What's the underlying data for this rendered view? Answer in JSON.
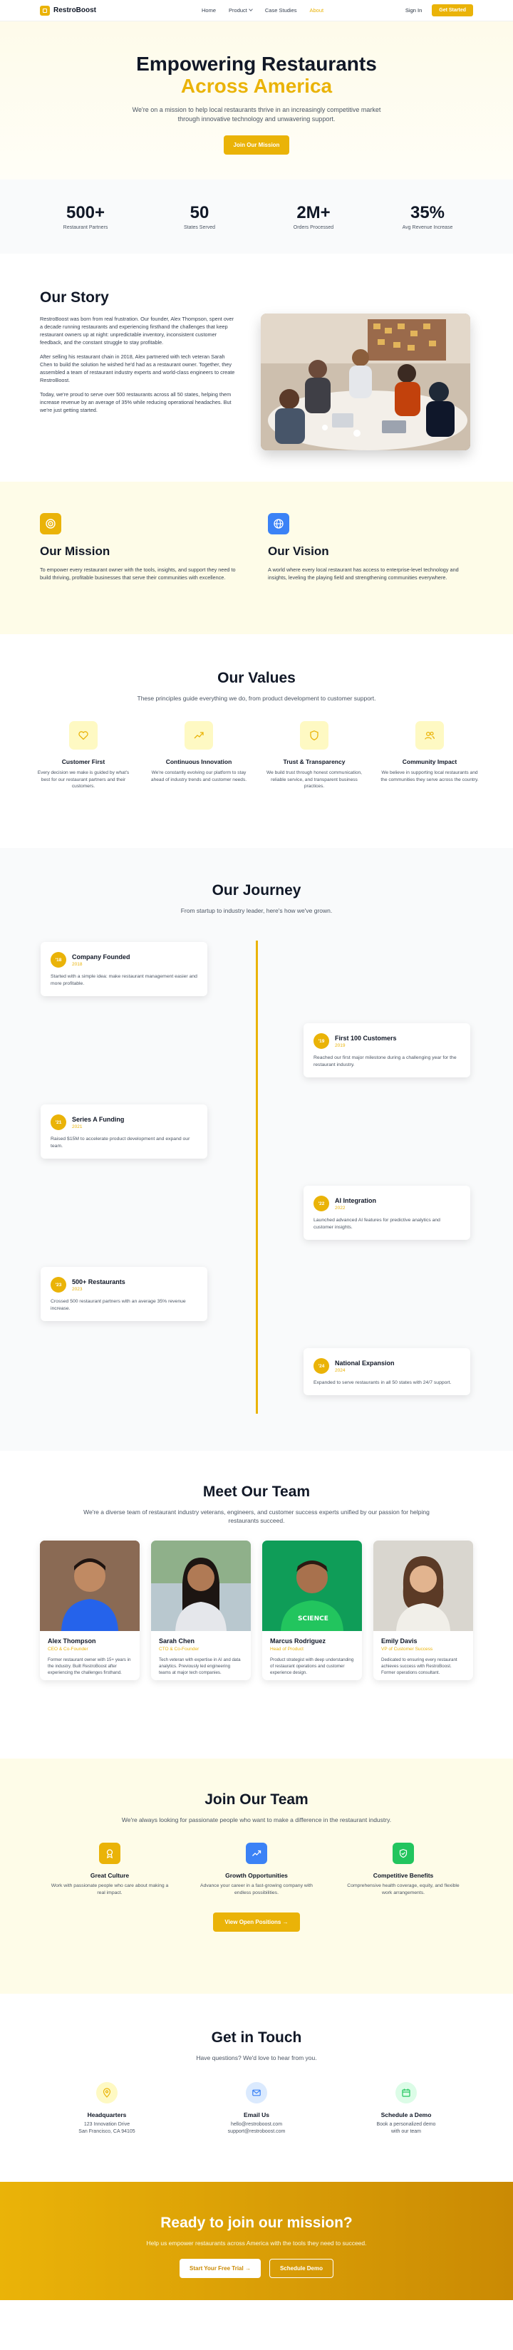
{
  "nav": {
    "brand": "RestroBoost",
    "links": [
      {
        "label": "Home"
      },
      {
        "label": "Product"
      },
      {
        "label": "Case Studies"
      },
      {
        "label": "About"
      }
    ],
    "sign_in": "Sign In",
    "get_started": "Get Started"
  },
  "hero": {
    "title_line1": "Empowering Restaurants",
    "title_line2": "Across America",
    "subtitle": "We're on a mission to help local restaurants thrive in an increasingly competitive market through innovative technology and unwavering support.",
    "cta": "Join Our Mission"
  },
  "stats": [
    {
      "value": "500+",
      "label": "Restaurant Partners"
    },
    {
      "value": "50",
      "label": "States Served"
    },
    {
      "value": "2M+",
      "label": "Orders Processed"
    },
    {
      "value": "35%",
      "label": "Avg Revenue Increase"
    }
  ],
  "story": {
    "title": "Our Story",
    "paragraphs": [
      "RestroBoost was born from real frustration. Our founder, Alex Thompson, spent over a decade running restaurants and experiencing firsthand the challenges that keep restaurant owners up at night: unpredictable inventory, inconsistent customer feedback, and the constant struggle to stay profitable.",
      "After selling his restaurant chain in 2018, Alex partnered with tech veteran Sarah Chen to build the solution he wished he'd had as a restaurant owner. Together, they assembled a team of restaurant industry experts and world-class engineers to create RestroBoost.",
      "Today, we're proud to serve over 500 restaurants across all 50 states, helping them increase revenue by an average of 35% while reducing operational headaches. But we're just getting started."
    ]
  },
  "mission": {
    "title": "Our Mission",
    "text": "To empower every restaurant owner with the tools, insights, and support they need to build thriving, profitable businesses that serve their communities with excellence."
  },
  "vision": {
    "title": "Our Vision",
    "text": "A world where every local restaurant has access to enterprise-level technology and insights, leveling the playing field and strengthening communities everywhere."
  },
  "values": {
    "title": "Our Values",
    "subtitle": "These principles guide everything we do, from product development to customer support.",
    "items": [
      {
        "title": "Customer First",
        "text": "Every decision we make is guided by what's best for our restaurant partners and their customers.",
        "icon": "heart-icon"
      },
      {
        "title": "Continuous Innovation",
        "text": "We're constantly evolving our platform to stay ahead of industry trends and customer needs.",
        "icon": "trending-up-icon"
      },
      {
        "title": "Trust & Transparency",
        "text": "We build trust through honest communication, reliable service, and transparent business practices.",
        "icon": "shield-icon"
      },
      {
        "title": "Community Impact",
        "text": "We believe in supporting local restaurants and the communities they serve across the country.",
        "icon": "users-icon"
      }
    ]
  },
  "journey": {
    "title": "Our Journey",
    "subtitle": "From startup to industry leader, here's how we've grown.",
    "events": [
      {
        "badge": "'18",
        "title": "Company Founded",
        "year": "2018",
        "text": "Started with a simple idea: make restaurant management easier and more profitable."
      },
      {
        "badge": "'19",
        "title": "First 100 Customers",
        "year": "2019",
        "text": "Reached our first major milestone during a challenging year for the restaurant industry."
      },
      {
        "badge": "'21",
        "title": "Series A Funding",
        "year": "2021",
        "text": "Raised $15M to accelerate product development and expand our team."
      },
      {
        "badge": "'22",
        "title": "AI Integration",
        "year": "2022",
        "text": "Launched advanced AI features for predictive analytics and customer insights."
      },
      {
        "badge": "'23",
        "title": "500+ Restaurants",
        "year": "2023",
        "text": "Crossed 500 restaurant partners with an average 35% revenue increase."
      },
      {
        "badge": "'24",
        "title": "National Expansion",
        "year": "2024",
        "text": "Expanded to serve restaurants in all 50 states with 24/7 support."
      }
    ]
  },
  "team": {
    "title": "Meet Our Team",
    "subtitle": "We're a diverse team of restaurant industry veterans, engineers, and customer success experts unified by our passion for helping restaurants succeed.",
    "members": [
      {
        "name": "Alex Thompson",
        "role": "CEO & Co-Founder",
        "bio": "Former restaurant owner with 15+ years in the industry. Built RestroBoost after experiencing the challenges firsthand."
      },
      {
        "name": "Sarah Chen",
        "role": "CTO & Co-Founder",
        "bio": "Tech veteran with expertise in AI and data analytics. Previously led engineering teams at major tech companies."
      },
      {
        "name": "Marcus Rodriguez",
        "role": "Head of Product",
        "bio": "Product strategist with deep understanding of restaurant operations and customer experience design."
      },
      {
        "name": "Emily Davis",
        "role": "VP of Customer Success",
        "bio": "Dedicated to ensuring every restaurant achieves success with RestroBoost. Former operations consultant."
      }
    ]
  },
  "join": {
    "title": "Join Our Team",
    "subtitle": "We're always looking for passionate people who want to make a difference in the restaurant industry.",
    "items": [
      {
        "title": "Great Culture",
        "text": "Work with passionate people who care about making a real impact."
      },
      {
        "title": "Growth Opportunities",
        "text": "Advance your career in a fast-growing company with endless possibilities."
      },
      {
        "title": "Competitive Benefits",
        "text": "Comprehensive health coverage, equity, and flexible work arrangements."
      }
    ],
    "cta": "View Open Positions"
  },
  "contact": {
    "title": "Get in Touch",
    "subtitle": "Have questions? We'd love to hear from you.",
    "items": [
      {
        "title": "Headquarters",
        "line1": "123 Innovation Drive",
        "line2": "San Francisco, CA 94105"
      },
      {
        "title": "Email Us",
        "line1": "hello@restroboost.com",
        "line2": "support@restroboost.com"
      },
      {
        "title": "Schedule a Demo",
        "line1": "Book a personalized demo",
        "line2": "with our team"
      }
    ]
  },
  "cta": {
    "title": "Ready to join our mission?",
    "subtitle": "Help us empower restaurants across America with the tools they need to succeed.",
    "primary": "Start Your Free Trial",
    "secondary": "Schedule Demo"
  },
  "colors": {
    "accent": "#eab308",
    "accent_dark": "#ca8a04",
    "blue": "#3b82f6",
    "green": "#22c55e"
  }
}
